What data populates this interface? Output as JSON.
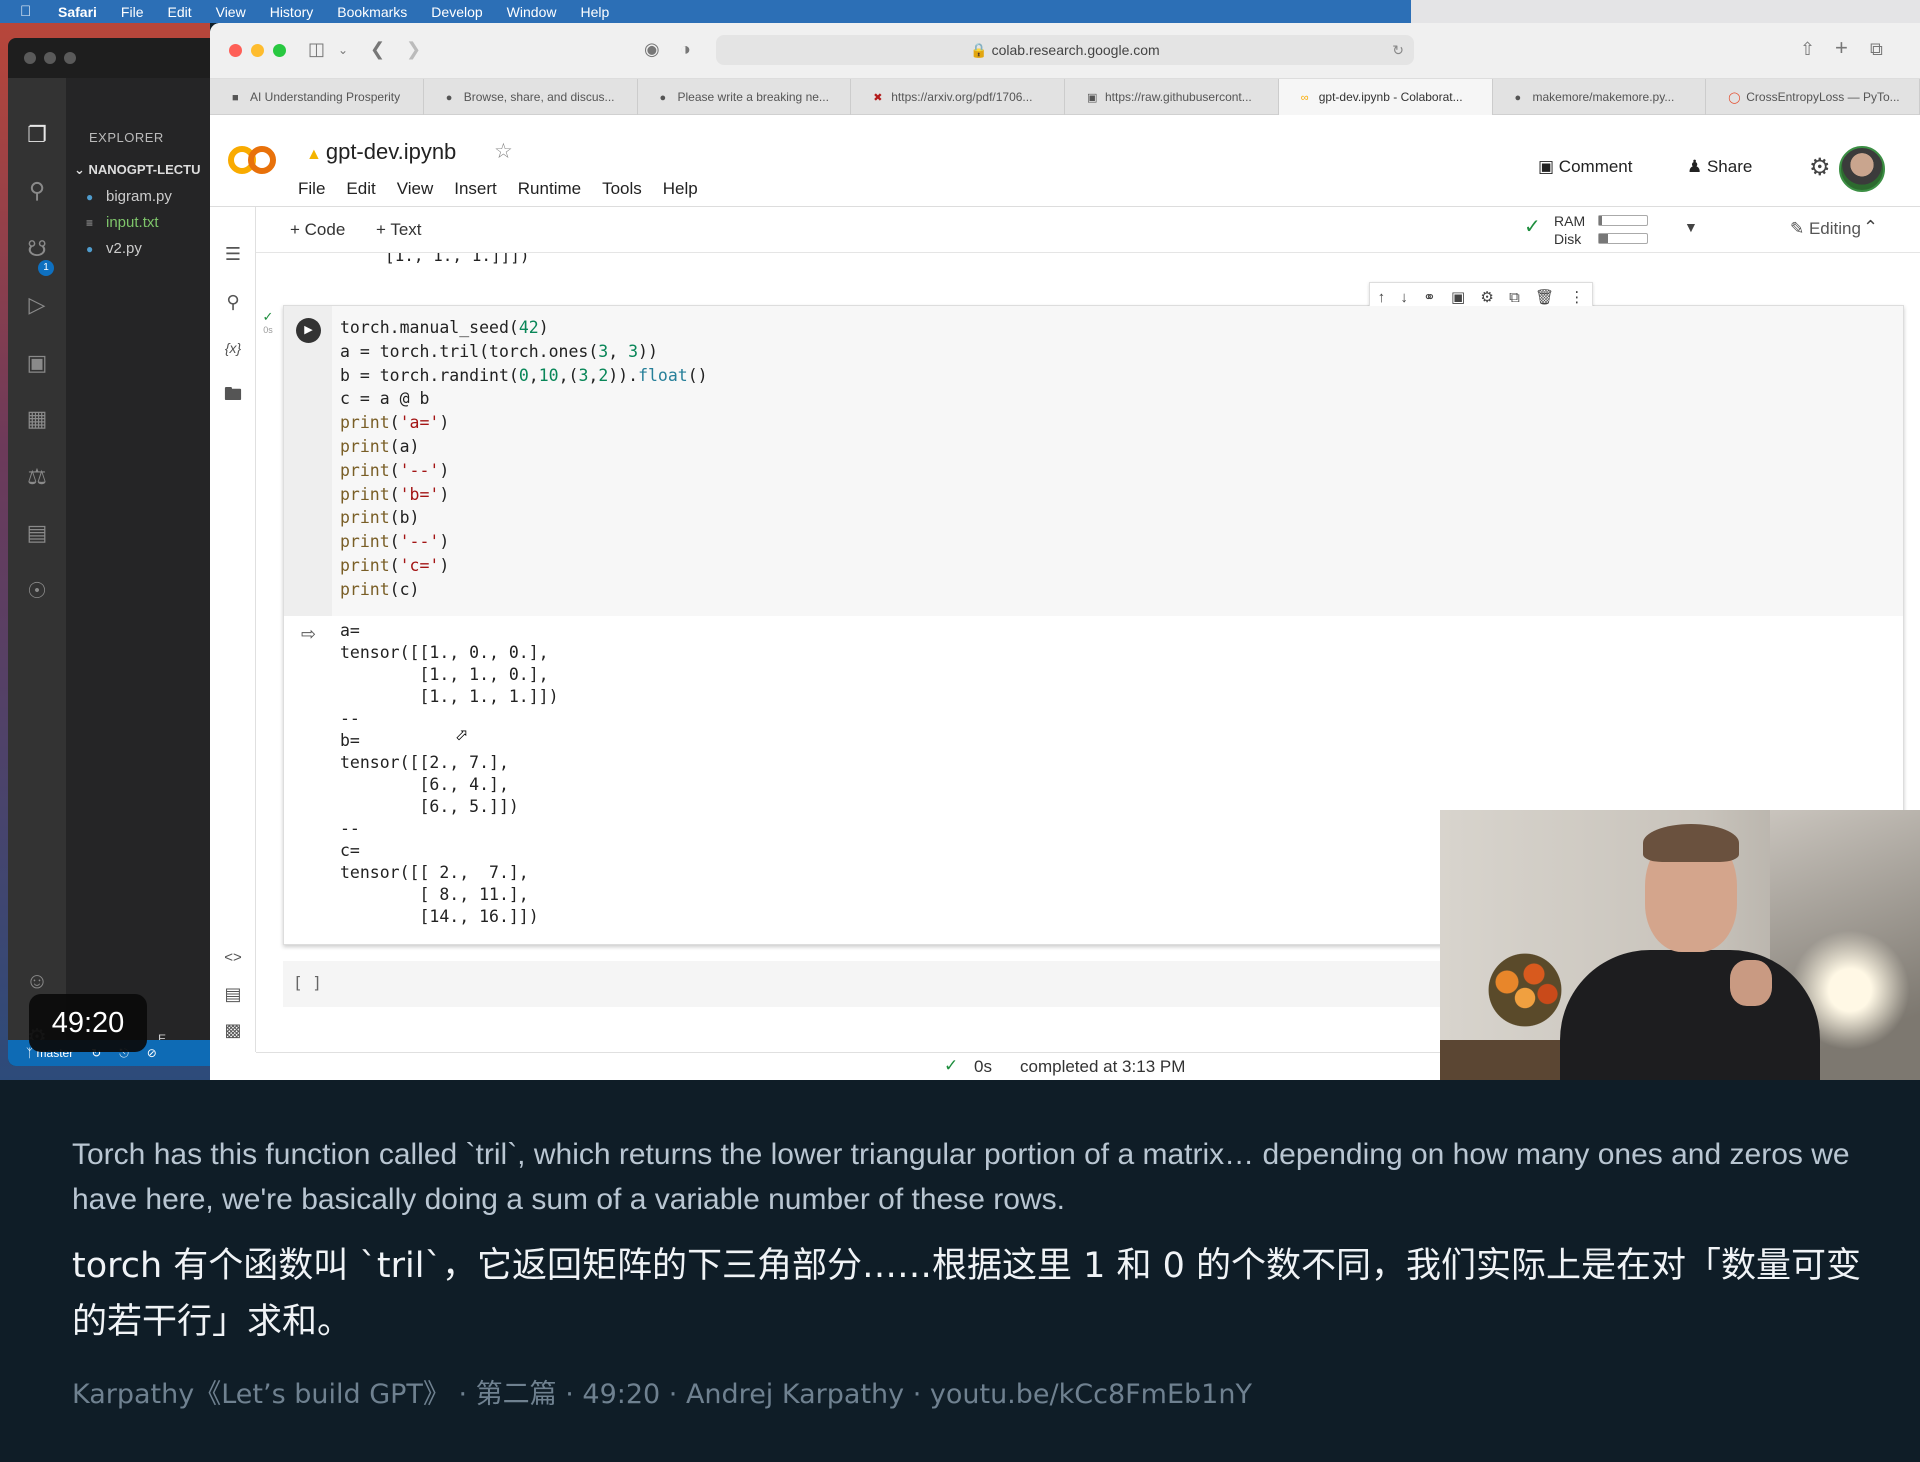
{
  "menubar": {
    "app": "Safari",
    "items": [
      "File",
      "Edit",
      "View",
      "History",
      "Bookmarks",
      "Develop",
      "Window",
      "Help"
    ]
  },
  "vscode": {
    "explorer_title": "EXPLORER",
    "folder": "NANOGPT-LECTU",
    "files": [
      "bigram.py",
      "input.txt",
      "v2.py"
    ],
    "scm_badge": "1",
    "branch": "master",
    "status_fragment_1": "E",
    "status_fragment_2": "E"
  },
  "timestamp": "49:20",
  "safari": {
    "url": "colab.research.google.com",
    "tabs": [
      "AI Understanding Prosperity",
      "Browse, share, and discus...",
      "Please write a breaking ne...",
      "https://arxiv.org/pdf/1706...",
      "https://raw.githubusercont...",
      "gpt-dev.ipynb - Colaborat...",
      "makemore/makemore.py...",
      "CrossEntropyLoss — PyTo..."
    ],
    "active_tab": 5
  },
  "colab": {
    "title": "gpt-dev.ipynb",
    "menu": [
      "File",
      "Edit",
      "View",
      "Insert",
      "Runtime",
      "Tools",
      "Help"
    ],
    "comment": "Comment",
    "share": "Share",
    "add_code": "+ Code",
    "add_text": "+ Text",
    "ram_label": "RAM",
    "disk_label": "Disk",
    "ram_usage": 0.06,
    "disk_usage": 0.18,
    "editing": "Editing",
    "prev_output_tail": "[1., 1., 1.]]])",
    "exec_time": "0s",
    "empty_cell": "[ ]",
    "status_time": "0s",
    "status_text": "completed at 3:13 PM",
    "output": "a=\ntensor([[1., 0., 0.],\n        [1., 1., 0.],\n        [1., 1., 1.]])\n--\nb=\ntensor([[2., 7.],\n        [6., 4.],\n        [6., 5.]])\n--\nc=\ntensor([[ 2.,  7.],\n        [ 8., 11.],\n        [14., 16.]])"
  },
  "subtitles": {
    "english": "Torch has this function called `tril`, which returns the lower triangular portion of a matrix… depending on how many ones and zeros we have here, we're basically doing a sum of a variable number of these rows.",
    "chinese": "torch 有个函数叫 `tril`，它返回矩阵的下三角部分……根据这里 1 和 0 的个数不同，我们实际上是在对「数量可变的若干行」求和。",
    "meta": "Karpathy《Let’s build GPT》 · 第二篇 · 49:20 · Andrej Karpathy · youtu.be/kCc8FmEb1nY"
  }
}
